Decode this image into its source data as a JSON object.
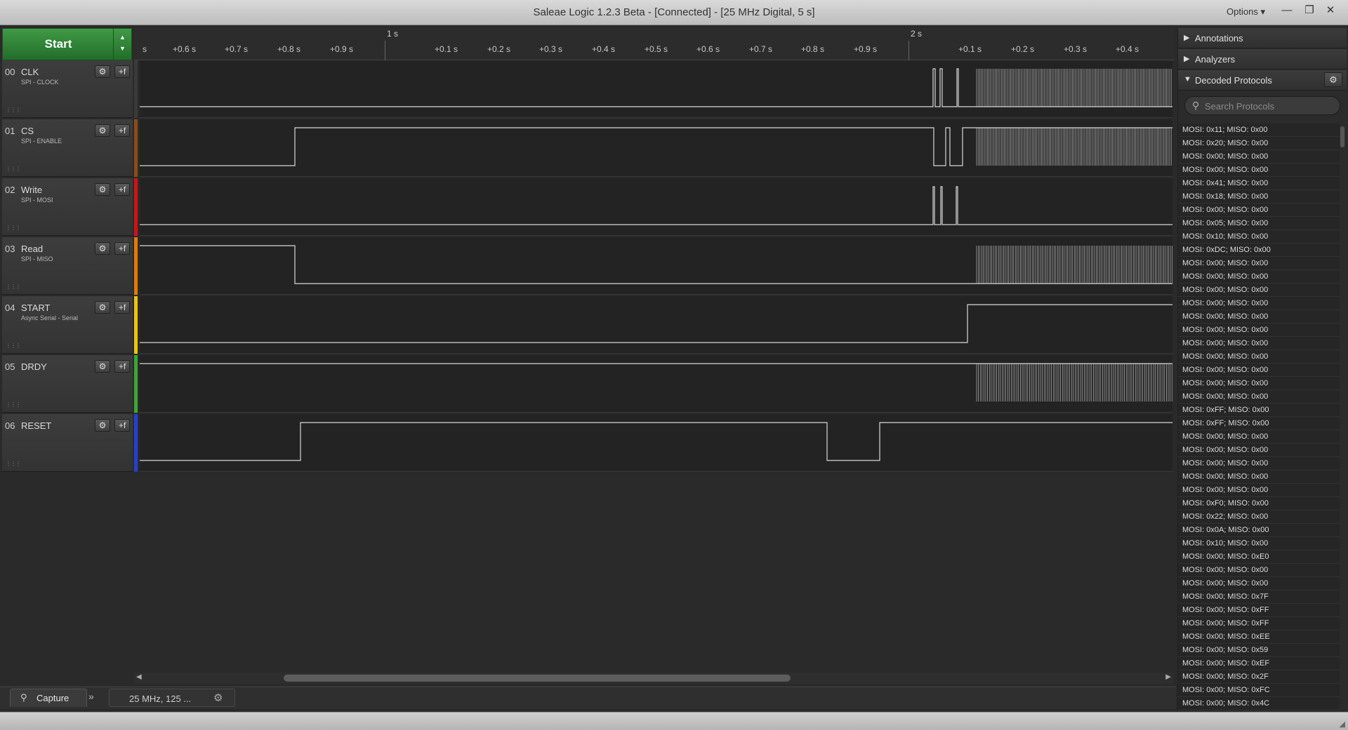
{
  "window": {
    "title": "Saleae Logic 1.2.3 Beta - [Connected] - [25 MHz Digital, 5 s]",
    "options_label": "Options ▾",
    "minimize": "—",
    "maximize": "❐",
    "close": "✕"
  },
  "start_button": {
    "label": "Start",
    "up_arrow": "▲",
    "down_arrow": "▼"
  },
  "ruler": {
    "major_labels": [
      "1 s",
      "2 s"
    ],
    "minor_labels": [
      "s",
      "+0.6 s",
      "+0.7 s",
      "+0.8 s",
      "+0.9 s",
      "+0.1 s",
      "+0.2 s",
      "+0.3 s",
      "+0.4 s",
      "+0.5 s",
      "+0.6 s",
      "+0.7 s",
      "+0.8 s",
      "+0.9 s",
      "+0.1 s",
      "+0.2 s",
      "+0.3 s",
      "+0.4 s"
    ]
  },
  "channels": [
    {
      "num": "00",
      "name": "CLK",
      "sub": "SPI - CLOCK",
      "color": "#3a3a3a"
    },
    {
      "num": "01",
      "name": "CS",
      "sub": "SPI - ENABLE",
      "color": "#8b4a1e"
    },
    {
      "num": "02",
      "name": "Write",
      "sub": "SPI - MOSI",
      "color": "#c8161d"
    },
    {
      "num": "03",
      "name": "Read",
      "sub": "SPI - MISO",
      "color": "#e07a10"
    },
    {
      "num": "04",
      "name": "START",
      "sub": "Async Serial - Serial",
      "color": "#e8c416"
    },
    {
      "num": "05",
      "name": "DRDY",
      "sub": "",
      "color": "#3fa535"
    },
    {
      "num": "06",
      "name": "RESET",
      "sub": "",
      "color": "#2b3fc8"
    }
  ],
  "channel_buttons": {
    "gear": "⚙",
    "plus": "+f",
    "grip": "⋮⋮⋮"
  },
  "bottom": {
    "capture_tab": "Capture",
    "capture_icon": "⚲",
    "more_icon": "»",
    "rate_label": "25 MHz, 125 ...",
    "rate_gear": "⚙",
    "scroll_left": "◀",
    "scroll_right": "▶"
  },
  "side_panel": {
    "annotations": "Annotations",
    "analyzers": "Analyzers",
    "decoded_protocols": "Decoded Protocols",
    "collapsed_tri": "▶",
    "expanded_tri": "▼",
    "gear": "⚙",
    "search_placeholder": "Search Protocols",
    "search_icon": "⚲"
  },
  "decoded_rows": [
    "MOSI: 0x11;  MISO: 0x00",
    "MOSI: 0x20;  MISO: 0x00",
    "MOSI: 0x00;  MISO: 0x00",
    "MOSI: 0x00;  MISO: 0x00",
    "MOSI: 0x41;  MISO: 0x00",
    "MOSI: 0x18;  MISO: 0x00",
    "MOSI: 0x00;  MISO: 0x00",
    "MOSI: 0x05;  MISO: 0x00",
    "MOSI: 0x10;  MISO: 0x00",
    "MOSI: 0xDC;  MISO: 0x00",
    "MOSI: 0x00;  MISO: 0x00",
    "MOSI: 0x00;  MISO: 0x00",
    "MOSI: 0x00;  MISO: 0x00",
    "MOSI: 0x00;  MISO: 0x00",
    "MOSI: 0x00;  MISO: 0x00",
    "MOSI: 0x00;  MISO: 0x00",
    "MOSI: 0x00;  MISO: 0x00",
    "MOSI: 0x00;  MISO: 0x00",
    "MOSI: 0x00;  MISO: 0x00",
    "MOSI: 0x00;  MISO: 0x00",
    "MOSI: 0x00;  MISO: 0x00",
    "MOSI: 0xFF;  MISO: 0x00",
    "MOSI: 0xFF;  MISO: 0x00",
    "MOSI: 0x00;  MISO: 0x00",
    "MOSI: 0x00;  MISO: 0x00",
    "MOSI: 0x00;  MISO: 0x00",
    "MOSI: 0x00;  MISO: 0x00",
    "MOSI: 0x00;  MISO: 0x00",
    "MOSI: 0xF0;  MISO: 0x00",
    "MOSI: 0x22;  MISO: 0x00",
    "MOSI: 0x0A;  MISO: 0x00",
    "MOSI: 0x10;  MISO: 0x00",
    "MOSI: 0x00;  MISO: 0xE0",
    "MOSI: 0x00;  MISO: 0x00",
    "MOSI: 0x00;  MISO: 0x00",
    "MOSI: 0x00;  MISO: 0x7F",
    "MOSI: 0x00;  MISO: 0xFF",
    "MOSI: 0x00;  MISO: 0xFF",
    "MOSI: 0x00;  MISO: 0xEE",
    "MOSI: 0x00;  MISO: 0x59",
    "MOSI: 0x00;  MISO: 0xEF",
    "MOSI: 0x00;  MISO: 0x2F",
    "MOSI: 0x00;  MISO: 0xFC",
    "MOSI: 0x00;  MISO: 0x4C"
  ]
}
